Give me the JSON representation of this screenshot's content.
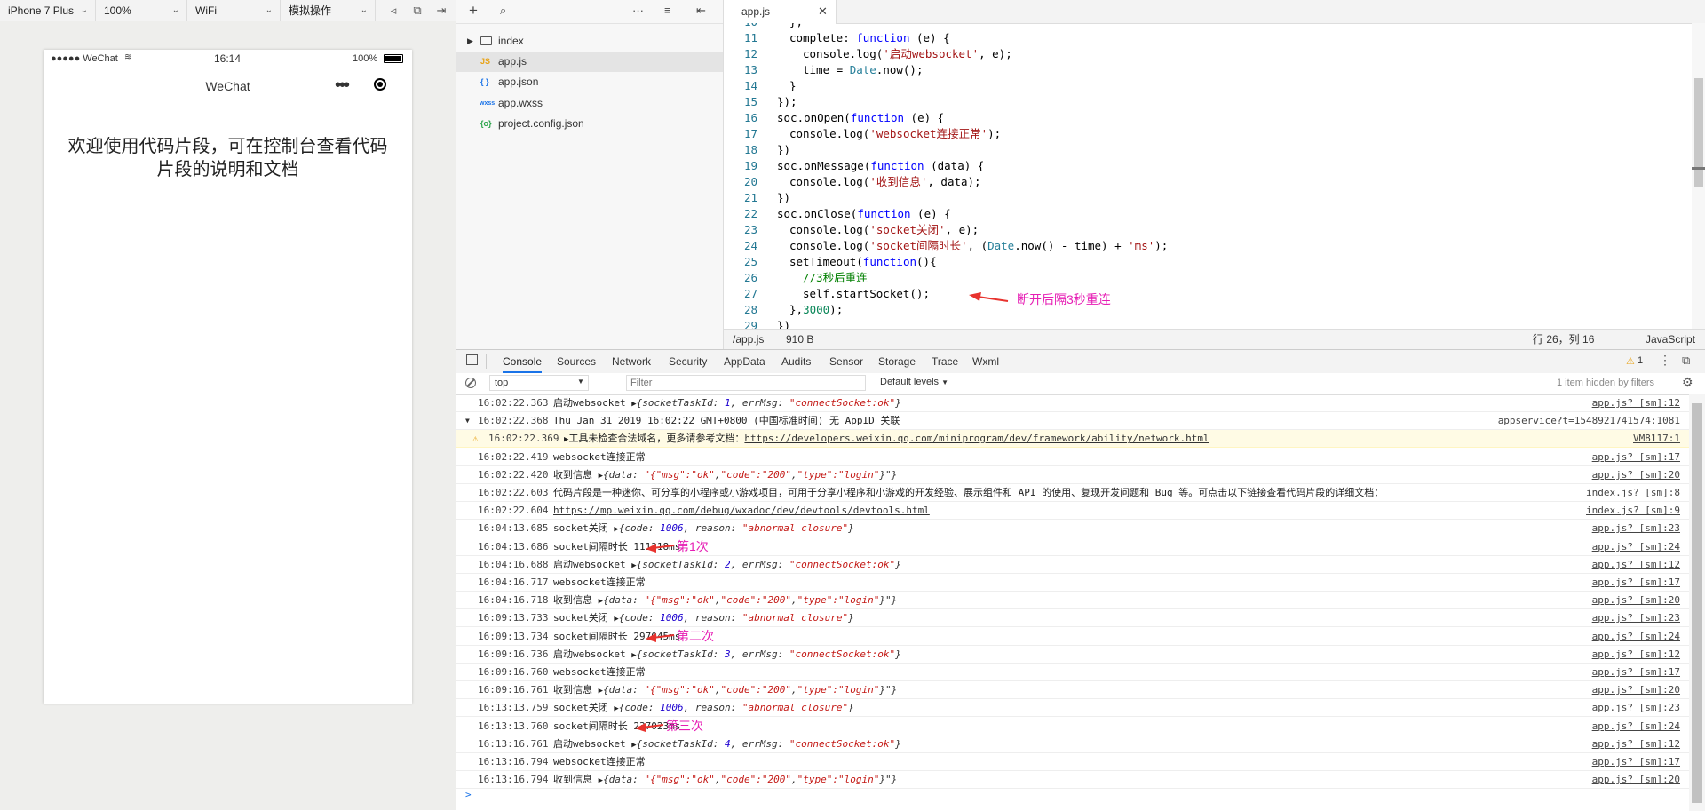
{
  "toolbar": {
    "device": "iPhone 7 Plus",
    "zoom": "100%",
    "network": "WiFi",
    "operation": "模拟操作"
  },
  "phone": {
    "carrier": "●●●●● WeChat",
    "time": "16:14",
    "battery": "100%",
    "nav_title": "WeChat",
    "welcome": "欢迎使用代码片段，可在控制台查看代码片段的说明和文档"
  },
  "filetree": {
    "folder": "index",
    "files": [
      {
        "icon": "JS",
        "name": "app.js"
      },
      {
        "icon": "{ }",
        "name": "app.json"
      },
      {
        "icon": "wxss",
        "name": "app.wxss"
      },
      {
        "icon": "{o}",
        "name": "project.config.json"
      }
    ]
  },
  "editor": {
    "tab": "app.js",
    "first_line_partial": "10",
    "lines": [
      {
        "n": "11"
      },
      {
        "n": "12"
      },
      {
        "n": "13"
      },
      {
        "n": "14"
      },
      {
        "n": "15"
      },
      {
        "n": "16"
      },
      {
        "n": "17"
      },
      {
        "n": "18"
      },
      {
        "n": "19"
      },
      {
        "n": "20"
      },
      {
        "n": "21"
      },
      {
        "n": "22"
      },
      {
        "n": "23"
      },
      {
        "n": "24"
      },
      {
        "n": "25"
      },
      {
        "n": "26"
      },
      {
        "n": "27"
      },
      {
        "n": "28"
      },
      {
        "n": "29"
      }
    ],
    "code_annotation": "断开后隔3秒重连",
    "status_path": "/app.js",
    "status_size": "910 B",
    "status_cursor": "行 26，列 16",
    "status_lang": "JavaScript"
  },
  "devtools": {
    "tabs": [
      "Console",
      "Sources",
      "Network",
      "Security",
      "AppData",
      "Audits",
      "Sensor",
      "Storage",
      "Trace",
      "Wxml"
    ],
    "warning_count": "1",
    "context": "top",
    "filter_placeholder": "Filter",
    "levels": "Default levels",
    "hidden_info": "1 item hidden by filters",
    "prompt": ">"
  },
  "console_rows": [
    {
      "ts": "16:02:22.363",
      "msg": "启动websocket ",
      "obj": "{socketTaskId: 1, errMsg: \"connectSocket:ok\"}",
      "src": "app.js? [sm]:12"
    },
    {
      "ts": "16:02:22.368",
      "msg": "Thu Jan 31 2019 16:02:22 GMT+0800 (中国标准时间) 无 AppID 关联",
      "obj": "",
      "src": "appservice?t=1548921741574:1081"
    },
    {
      "ts": "16:02:22.369",
      "msg": "工具未检查合法域名，更多请参考文档：",
      "link": "https://developers.weixin.qq.com/miniprogram/dev/framework/ability/network.html",
      "obj": "",
      "src": "VM8117:1",
      "warn": true
    },
    {
      "ts": "16:02:22.419",
      "msg": "websocket连接正常",
      "obj": "",
      "src": "app.js? [sm]:17"
    },
    {
      "ts": "16:02:22.420",
      "msg": "收到信息 ",
      "obj": "{data: \"{\"msg\":\"ok\",\"code\":\"200\",\"type\":\"login\"}\"}",
      "src": "app.js? [sm]:20"
    },
    {
      "ts": "16:02:22.603",
      "msg": "代码片段是一种迷你、可分享的小程序或小游戏项目，可用于分享小程序和小游戏的开发经验、展示组件和 API 的使用、复现开发问题和 Bug 等。可点击以下链接查看代码片段的详细文档：",
      "obj": "",
      "src": "index.js? [sm]:8"
    },
    {
      "ts": "16:02:22.604",
      "msg": "",
      "link": "https://mp.weixin.qq.com/debug/wxadoc/dev/devtools/devtools.html",
      "obj": "",
      "src": "index.js? [sm]:9"
    },
    {
      "ts": "16:04:13.685",
      "msg": "socket关闭 ",
      "obj": "{code: 1006, reason: \"abnormal closure\"}",
      "src": "app.js? [sm]:23"
    },
    {
      "ts": "16:04:13.686",
      "msg": "socket间隔时长 111318ms",
      "obj": "",
      "src": "app.js? [sm]:24",
      "note": "第1次"
    },
    {
      "ts": "16:04:16.688",
      "msg": "启动websocket ",
      "obj": "{socketTaskId: 2, errMsg: \"connectSocket:ok\"}",
      "src": "app.js? [sm]:12"
    },
    {
      "ts": "16:04:16.717",
      "msg": "websocket连接正常",
      "obj": "",
      "src": "app.js? [sm]:17"
    },
    {
      "ts": "16:04:16.718",
      "msg": "收到信息 ",
      "obj": "{data: \"{\"msg\":\"ok\",\"code\":\"200\",\"type\":\"login\"}\"}",
      "src": "app.js? [sm]:20"
    },
    {
      "ts": "16:09:13.733",
      "msg": "socket关闭 ",
      "obj": "{code: 1006, reason: \"abnormal closure\"}",
      "src": "app.js? [sm]:23"
    },
    {
      "ts": "16:09:13.734",
      "msg": "socket间隔时长 297045ms",
      "obj": "",
      "src": "app.js? [sm]:24",
      "note": "第二次"
    },
    {
      "ts": "16:09:16.736",
      "msg": "启动websocket ",
      "obj": "{socketTaskId: 3, errMsg: \"connectSocket:ok\"}",
      "src": "app.js? [sm]:12"
    },
    {
      "ts": "16:09:16.760",
      "msg": "websocket连接正常",
      "obj": "",
      "src": "app.js? [sm]:17"
    },
    {
      "ts": "16:09:16.761",
      "msg": "收到信息 ",
      "obj": "{data: \"{\"msg\":\"ok\",\"code\":\"200\",\"type\":\"login\"}\"}",
      "src": "app.js? [sm]:20"
    },
    {
      "ts": "16:13:13.759",
      "msg": "socket关闭 ",
      "obj": "{code: 1006, reason: \"abnormal closure\"}",
      "src": "app.js? [sm]:23"
    },
    {
      "ts": "16:13:13.760",
      "msg": "socket间隔时长 237023ms",
      "obj": "",
      "src": "app.js? [sm]:24",
      "note": "第三次"
    },
    {
      "ts": "16:13:16.761",
      "msg": "启动websocket ",
      "obj": "{socketTaskId: 4, errMsg: \"connectSocket:ok\"}",
      "src": "app.js? [sm]:12"
    },
    {
      "ts": "16:13:16.794",
      "msg": "websocket连接正常",
      "obj": "",
      "src": "app.js? [sm]:17"
    },
    {
      "ts": "16:13:16.794",
      "msg": "收到信息 ",
      "obj": "{data: \"{\"msg\":\"ok\",\"code\":\"200\",\"type\":\"login\"}\"}",
      "src": "app.js? [sm]:20"
    }
  ],
  "colors": {
    "annotation": "#e61eb4",
    "arrow": "#e8332e",
    "keyword": "#0000ff",
    "string": "#a31515",
    "comment": "#008000",
    "active_tab": "#1a73e8"
  }
}
